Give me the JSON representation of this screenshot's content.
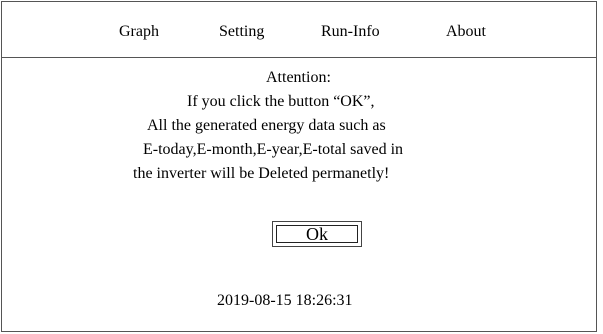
{
  "menu": {
    "items": [
      {
        "label": "Graph"
      },
      {
        "label": "Setting"
      },
      {
        "label": "Run-Info"
      },
      {
        "label": "About"
      }
    ]
  },
  "dialog": {
    "title": "Attention:",
    "lines": [
      "If you click the button “OK”,",
      "All the  generated energy data such as",
      "E-today,E-month,E-year,E-total saved in",
      "the inverter will be Deleted permanetly!"
    ],
    "ok_label": "Ok"
  },
  "status": {
    "timestamp": "2019-08-15 18:26:31"
  }
}
